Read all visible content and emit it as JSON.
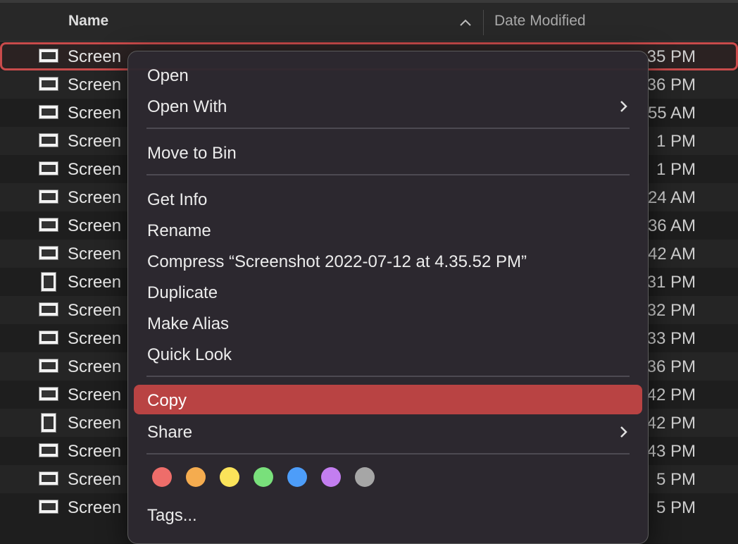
{
  "header": {
    "name_label": "Name",
    "date_label": "Date Modified"
  },
  "rows": [
    {
      "name": "Screen",
      "date": "35 PM",
      "selected": true
    },
    {
      "name": "Screen",
      "date": "36 PM"
    },
    {
      "name": "Screen",
      "date": "55 AM"
    },
    {
      "name": "Screen",
      "date": "1 PM"
    },
    {
      "name": "Screen",
      "date": "1 PM"
    },
    {
      "name": "Screen",
      "date": "24 AM"
    },
    {
      "name": "Screen",
      "date": "36 AM"
    },
    {
      "name": "Screen",
      "date": "42 AM"
    },
    {
      "name": "Screen",
      "date": "31 PM"
    },
    {
      "name": "Screen",
      "date": "32 PM"
    },
    {
      "name": "Screen",
      "date": "33 PM"
    },
    {
      "name": "Screen",
      "date": "36 PM"
    },
    {
      "name": "Screen",
      "date": "42 PM"
    },
    {
      "name": "Screen",
      "date": "42 PM"
    },
    {
      "name": "Screen",
      "date": "43 PM"
    },
    {
      "name": "Screen",
      "date": "5 PM"
    },
    {
      "name": "Screen",
      "date": "5 PM"
    }
  ],
  "menu": {
    "open": "Open",
    "open_with": "Open With",
    "move_to_bin": "Move to Bin",
    "get_info": "Get Info",
    "rename": "Rename",
    "compress": "Compress “Screenshot 2022-07-12 at 4.35.52 PM”",
    "duplicate": "Duplicate",
    "make_alias": "Make Alias",
    "quick_look": "Quick Look",
    "copy": "Copy",
    "share": "Share",
    "tags": "Tags..."
  },
  "tag_colors": [
    {
      "name": "red",
      "color": "#ee6d6a"
    },
    {
      "name": "orange",
      "color": "#f5ac4f"
    },
    {
      "name": "yellow",
      "color": "#fbe35a"
    },
    {
      "name": "green",
      "color": "#79e07b"
    },
    {
      "name": "blue",
      "color": "#4d9df9"
    },
    {
      "name": "purple",
      "color": "#c37ef0"
    },
    {
      "name": "gray",
      "color": "#a6a6a6"
    }
  ],
  "colors": {
    "highlight": "#b94343",
    "selection_outline": "#c94b4b"
  }
}
